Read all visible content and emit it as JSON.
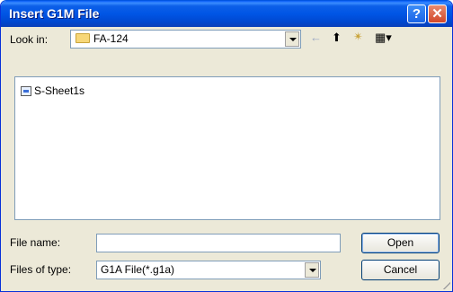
{
  "window": {
    "title": "Insert G1M File"
  },
  "titlebar": {
    "help_icon": "?",
    "close_icon": "✕"
  },
  "look_in": {
    "label": "Look in:",
    "value": "FA-124"
  },
  "toolbar": {
    "back_icon": "←",
    "up_icon": "⬆",
    "new_folder_icon": "✴",
    "views_icon": "▦▾"
  },
  "files": [
    {
      "name": "S-Sheet1s"
    }
  ],
  "file_name": {
    "label": "File name:",
    "value": ""
  },
  "files_of_type": {
    "label": "Files of type:",
    "value": "G1A File(*.g1a)"
  },
  "buttons": {
    "open": "Open",
    "cancel": "Cancel"
  }
}
